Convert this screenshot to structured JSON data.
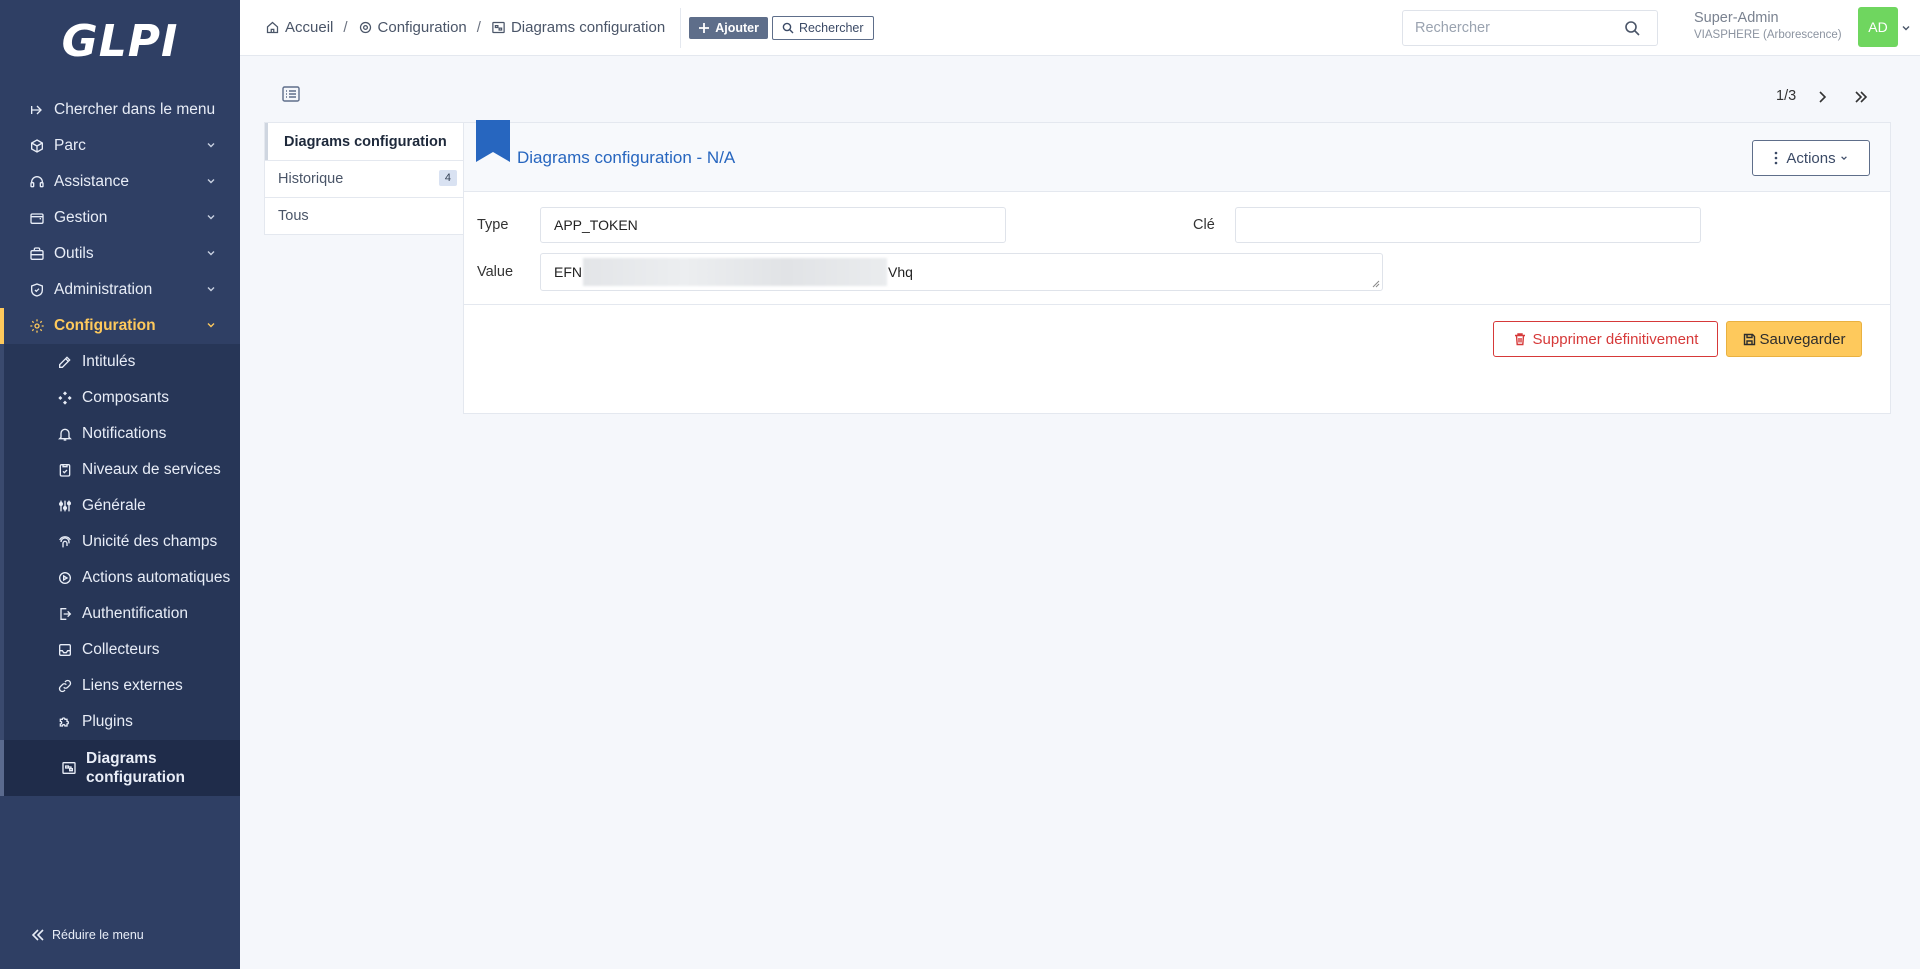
{
  "app": {
    "logo": "GLPI"
  },
  "sidebar": {
    "search_menu": "Chercher dans le menu",
    "items": [
      {
        "label": "Parc",
        "icon": "box-icon"
      },
      {
        "label": "Assistance",
        "icon": "headset-icon"
      },
      {
        "label": "Gestion",
        "icon": "wallet-icon"
      },
      {
        "label": "Outils",
        "icon": "briefcase-icon"
      },
      {
        "label": "Administration",
        "icon": "shield-icon"
      },
      {
        "label": "Configuration",
        "icon": "gear-icon"
      }
    ],
    "submenu": [
      {
        "label": "Intitulés",
        "icon": "edit-icon"
      },
      {
        "label": "Composants",
        "icon": "components-icon"
      },
      {
        "label": "Notifications",
        "icon": "bell-icon"
      },
      {
        "label": "Niveaux de services",
        "icon": "clipboard-check-icon"
      },
      {
        "label": "Générale",
        "icon": "adjustments-icon"
      },
      {
        "label": "Unicité des champs",
        "icon": "fingerprint-icon"
      },
      {
        "label": "Actions automatiques",
        "icon": "settings-automation-icon"
      },
      {
        "label": "Authentification",
        "icon": "login-icon"
      },
      {
        "label": "Collecteurs",
        "icon": "inbox-icon"
      },
      {
        "label": "Liens externes",
        "icon": "link-icon"
      },
      {
        "label": "Plugins",
        "icon": "puzzle-icon"
      },
      {
        "label": "Diagrams configuration",
        "icon": "diagram-icon"
      }
    ],
    "reduce": "Réduire le menu"
  },
  "header": {
    "breadcrumb": [
      "Accueil",
      "Configuration",
      "Diagrams configuration"
    ],
    "add_label": "Ajouter",
    "search_label": "Rechercher",
    "search_placeholder": "Rechercher",
    "user_name": "Super-Admin",
    "user_entity": "VIASPHERE (Arborescence)",
    "avatar_initials": "AD",
    "avatar_color": "#6fd65f"
  },
  "pager": {
    "text": "1/3"
  },
  "tabs": [
    {
      "label": "Diagrams configuration"
    },
    {
      "label": "Historique",
      "badge": "4"
    },
    {
      "label": "Tous"
    }
  ],
  "form": {
    "title": "Diagrams configuration - N/A",
    "actions_label": "Actions",
    "type_label": "Type",
    "type_value": "APP_TOKEN",
    "key_label": "Clé",
    "key_value": "",
    "value_label": "Value",
    "value_prefix": "EFN",
    "value_suffix": "Vhq",
    "delete_label": "Supprimer définitivement",
    "save_label": "Sauvegarder"
  },
  "colors": {
    "sidebar": "#2f3f64",
    "accent": "#fec95c",
    "title": "#2766bf",
    "danger": "#d63939"
  }
}
